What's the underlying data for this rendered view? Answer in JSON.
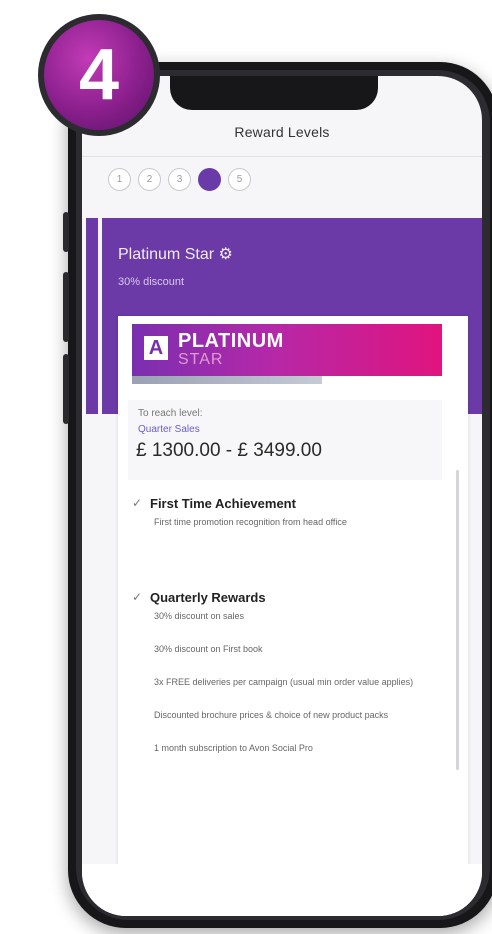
{
  "badge": {
    "number": "4"
  },
  "header": {
    "title": "Reward Levels"
  },
  "stepper": {
    "steps": [
      "1",
      "2",
      "3",
      "4",
      "5"
    ],
    "active_index": 3
  },
  "level": {
    "name": "Platinum Star ⚙",
    "discount": "30% discount"
  },
  "card": {
    "logo_title": "PLATINUM",
    "logo_sub": "STAR",
    "to_reach_label": "To reach level:",
    "sales_label": "Quarter Sales",
    "range": "£ 1300.00 - £ 3499.00"
  },
  "benefits": {
    "first_time": {
      "title": "First Time Achievement",
      "desc": "First time promotion recognition from head office"
    },
    "quarterly": {
      "title": "Quarterly Rewards",
      "items": [
        "30% discount on sales",
        "30% discount on First book",
        "3x FREE deliveries per campaign (usual min order value applies)",
        "Discounted brochure prices & choice of new product packs",
        "1 month subscription to Avon Social Pro"
      ]
    }
  },
  "colors": {
    "brand_purple": "#6b3aa6",
    "badge_magenta": "#8a1f8c",
    "logo_pink": "#e0147e"
  }
}
